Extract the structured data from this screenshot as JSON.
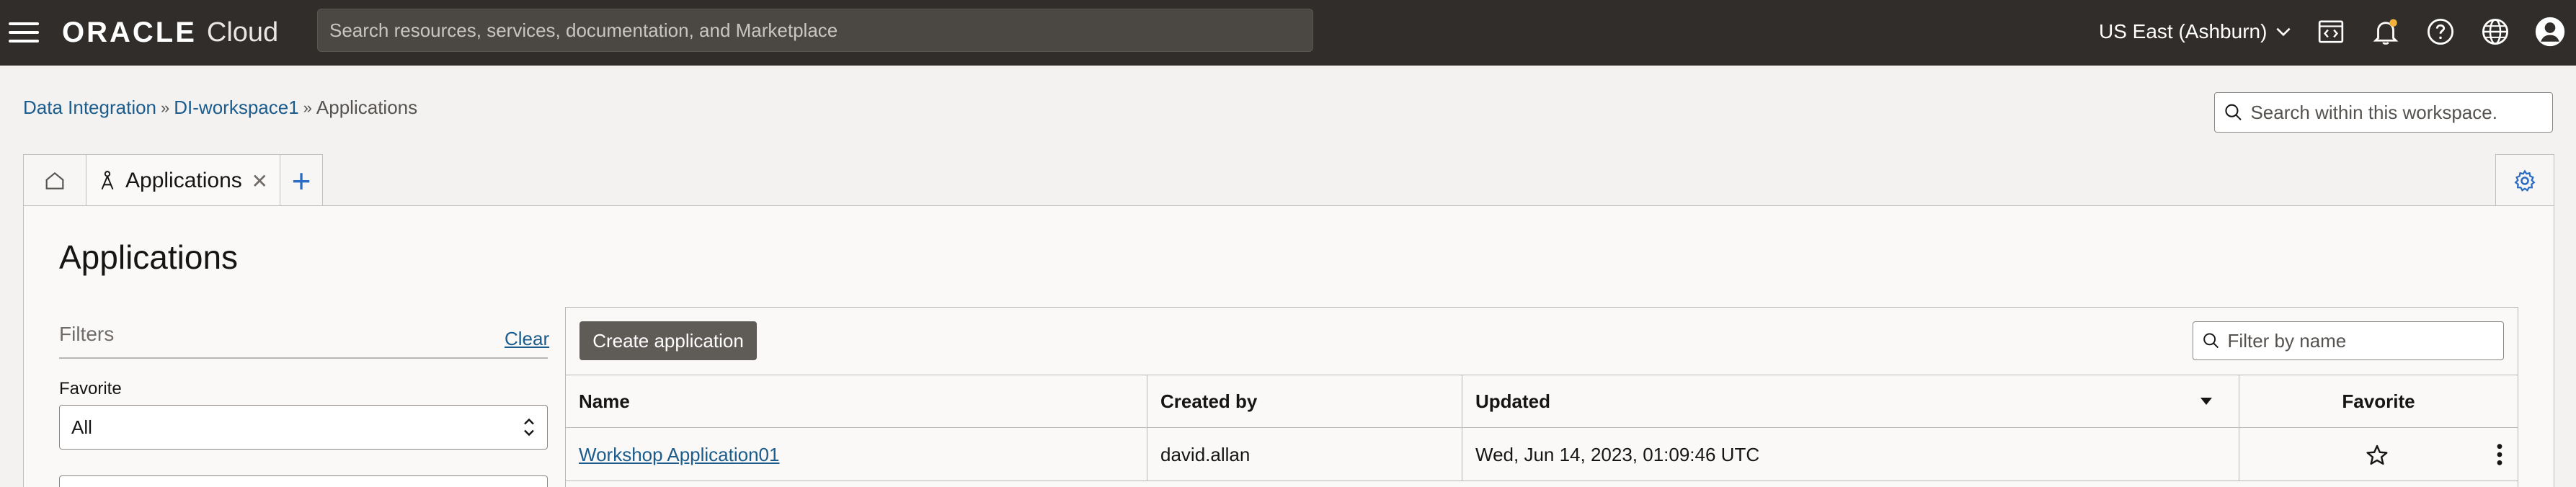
{
  "header": {
    "logo_brand": "ORACLE",
    "logo_product": "Cloud",
    "search_placeholder": "Search resources, services, documentation, and Marketplace",
    "region": "US East (Ashburn)",
    "icons": [
      "menu-icon",
      "code-editor-icon",
      "bell-icon",
      "help-icon",
      "globe-icon",
      "user-icon"
    ]
  },
  "breadcrumb": {
    "items": [
      "Data Integration",
      "DI-workspace1",
      "Applications"
    ],
    "separator": "»"
  },
  "workspace_search": {
    "placeholder": "Search within this workspace."
  },
  "tabs": {
    "home_icon": "home-icon",
    "active_label": "Applications",
    "active_icon": "application-icon",
    "add_label": "+",
    "settings_icon": "gear-icon"
  },
  "page": {
    "title": "Applications"
  },
  "filters": {
    "label": "Filters",
    "clear_label": "Clear",
    "favorite_label": "Favorite",
    "favorite_value": "All"
  },
  "toolbar": {
    "create_label": "Create application",
    "filter_placeholder": "Filter by name"
  },
  "table": {
    "columns": [
      "Name",
      "Created by",
      "Updated",
      "Favorite"
    ],
    "rows": [
      {
        "name": "Workshop Application01",
        "created_by": "david.allan",
        "updated": "Wed, Jun 14, 2023, 01:09:46 UTC"
      }
    ]
  },
  "colors": {
    "topbar": "#312d2a",
    "link": "#1b5c8c",
    "accent": "#2b6cc4",
    "button": "#5f5b57"
  }
}
